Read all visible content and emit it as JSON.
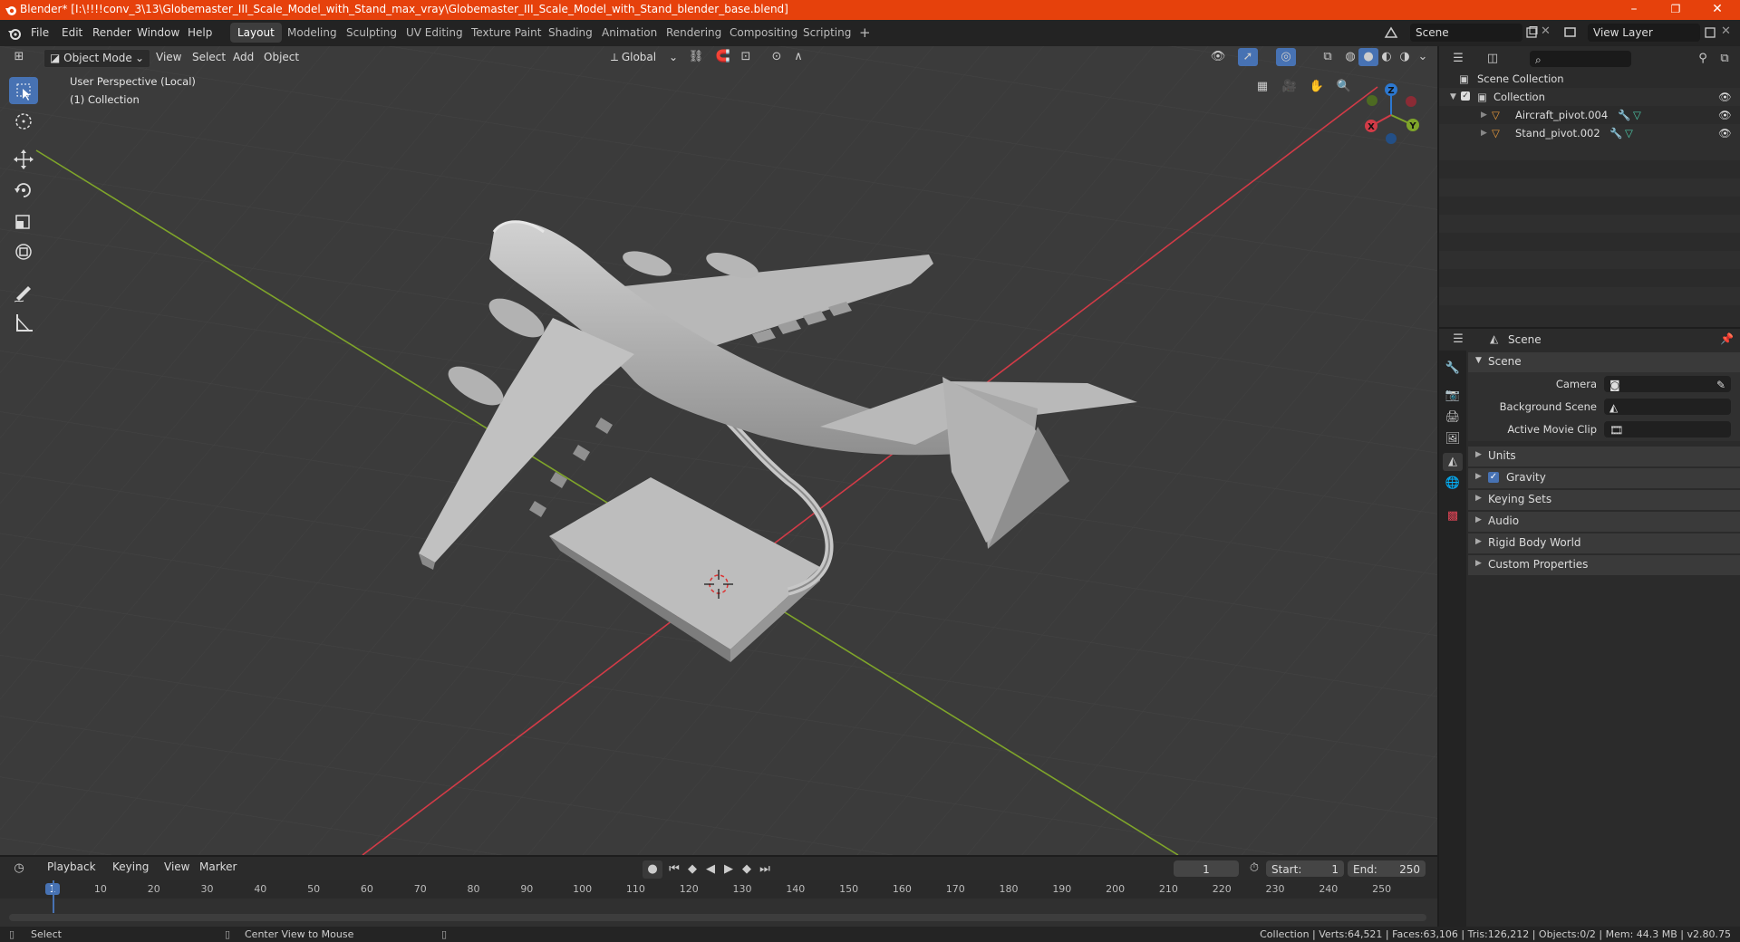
{
  "window": {
    "title": "Blender* [I:\\!!!!conv_3\\13\\Globemaster_III_Scale_Model_with_Stand_max_vray\\Globemaster_III_Scale_Model_with_Stand_blender_base.blend]",
    "minimize": "–",
    "maximize": "❐",
    "close": "✕"
  },
  "menubar": {
    "items": [
      "File",
      "Edit",
      "Render",
      "Window",
      "Help"
    ]
  },
  "workspaces": {
    "tabs": [
      "Layout",
      "Modeling",
      "Sculpting",
      "UV Editing",
      "Texture Paint",
      "Shading",
      "Animation",
      "Rendering",
      "Compositing",
      "Scripting"
    ],
    "active": "Layout",
    "add": "+"
  },
  "scene_selector": {
    "value": "Scene"
  },
  "view_layer_selector": {
    "value": "View Layer"
  },
  "viewport_header": {
    "mode": "Object Mode",
    "menus": [
      "View",
      "Select",
      "Add",
      "Object"
    ],
    "orientation": "Global"
  },
  "viewport": {
    "perspective_label": "User Perspective (Local)",
    "collection_label": "(1) Collection",
    "gizmo_axes": {
      "x": "X",
      "y": "Y",
      "z": "Z"
    },
    "colors": {
      "background": "#3b3b3b",
      "x_axis": "#d23b47",
      "y_axis": "#7fa52a",
      "z_axis": "#2c78d0"
    }
  },
  "outliner": {
    "root": "Scene Collection",
    "collection": "Collection",
    "objects": [
      "Aircraft_pivot.004",
      "Stand_pivot.002"
    ]
  },
  "properties": {
    "context": "Scene",
    "panel_title": "Scene",
    "fields": {
      "camera": "Camera",
      "background_scene": "Background Scene",
      "active_movie_clip": "Active Movie Clip"
    },
    "sections": [
      "Units",
      "Gravity",
      "Keying Sets",
      "Audio",
      "Rigid Body World",
      "Custom Properties"
    ],
    "gravity_checked": true
  },
  "timeline": {
    "menus": [
      "Playback",
      "Keying",
      "View",
      "Marker"
    ],
    "current_frame": "1",
    "start_label": "Start:",
    "start": "1",
    "end_label": "End:",
    "end": "250",
    "ruler": [
      "1",
      "10",
      "20",
      "30",
      "40",
      "50",
      "60",
      "70",
      "80",
      "90",
      "100",
      "110",
      "120",
      "130",
      "140",
      "150",
      "160",
      "170",
      "180",
      "190",
      "200",
      "210",
      "220",
      "230",
      "240",
      "250"
    ]
  },
  "statusbar": {
    "left": "Select",
    "middle": "Center View to Mouse",
    "right": "Collection | Verts:64,521 | Faces:63,106 | Tris:126,212 | Objects:0/2 | Mem: 44.3 MB | v2.80.75"
  }
}
